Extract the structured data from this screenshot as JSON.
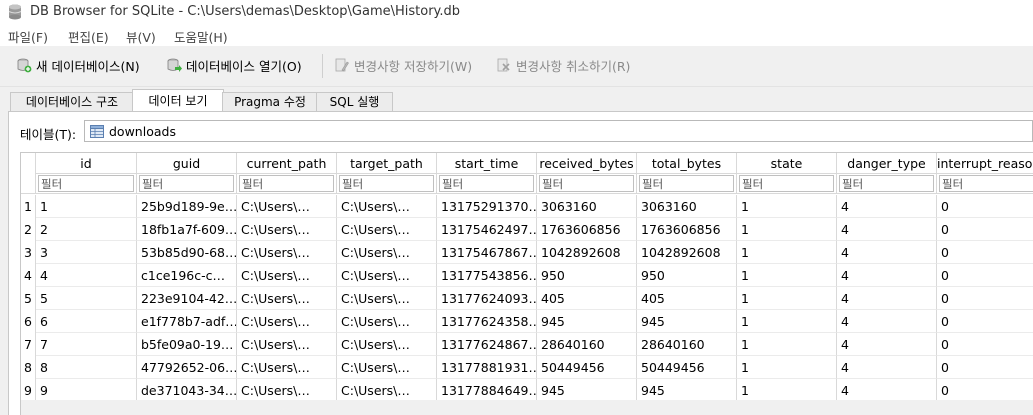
{
  "window": {
    "title": "DB Browser for SQLite - C:\\Users\\demas\\Desktop\\Game\\History.db",
    "icon": "database-icon"
  },
  "menu": [
    "파일(F)",
    "편집(E)",
    "뷰(V)",
    "도움말(H)"
  ],
  "toolbar": {
    "new_db": "새 데이터베이스(N)",
    "open_db": "데이터베이스 열기(O)",
    "write_changes": "변경사항 저장하기(W)",
    "revert_changes": "변경사항 취소하기(R)"
  },
  "tabs": [
    {
      "label": "데이터베이스 구조",
      "active": false
    },
    {
      "label": "데이터 보기",
      "active": true
    },
    {
      "label": "Pragma 수정",
      "active": false
    },
    {
      "label": "SQL 실행",
      "active": false
    }
  ],
  "table_selector": {
    "label": "테이블(T):",
    "value": "downloads"
  },
  "grid": {
    "filter_placeholder": "필터",
    "columns": [
      "id",
      "guid",
      "current_path",
      "target_path",
      "start_time",
      "received_bytes",
      "total_bytes",
      "state",
      "danger_type",
      "interrupt_reason"
    ],
    "rows": [
      {
        "num": "1",
        "cells": [
          "1",
          "25b9d189-9e…",
          "C:\\Users\\…",
          "C:\\Users\\…",
          "13175291370…",
          "3063160",
          "3063160",
          "1",
          "4",
          "0"
        ]
      },
      {
        "num": "2",
        "cells": [
          "2",
          "18fb1a7f-609…",
          "C:\\Users\\…",
          "C:\\Users\\…",
          "13175462497…",
          "1763606856",
          "1763606856",
          "1",
          "4",
          "0"
        ]
      },
      {
        "num": "3",
        "cells": [
          "3",
          "53b85d90-68…",
          "C:\\Users\\…",
          "C:\\Users\\…",
          "13175467867…",
          "1042892608",
          "1042892608",
          "1",
          "4",
          "0"
        ]
      },
      {
        "num": "4",
        "cells": [
          "4",
          "c1ce196c-c…",
          "C:\\Users\\…",
          "C:\\Users\\…",
          "13177543856…",
          "950",
          "950",
          "1",
          "4",
          "0"
        ]
      },
      {
        "num": "5",
        "cells": [
          "5",
          "223e9104-42…",
          "C:\\Users\\…",
          "C:\\Users\\…",
          "13177624093…",
          "405",
          "405",
          "1",
          "4",
          "0"
        ]
      },
      {
        "num": "6",
        "cells": [
          "6",
          "e1f778b7-adf…",
          "C:\\Users\\…",
          "C:\\Users\\…",
          "13177624358…",
          "945",
          "945",
          "1",
          "4",
          "0"
        ]
      },
      {
        "num": "7",
        "cells": [
          "7",
          "b5fe09a0-19…",
          "C:\\Users\\…",
          "C:\\Users\\…",
          "13177624867…",
          "28640160",
          "28640160",
          "1",
          "4",
          "0"
        ]
      },
      {
        "num": "8",
        "cells": [
          "8",
          "47792652-06…",
          "C:\\Users\\…",
          "C:\\Users\\…",
          "13177881931…",
          "50449456",
          "50449456",
          "1",
          "4",
          "0"
        ]
      },
      {
        "num": "9",
        "cells": [
          "9",
          "de371043-34…",
          "C:\\Users\\…",
          "C:\\Users\\…",
          "13177884649…",
          "945",
          "945",
          "1",
          "4",
          "0"
        ]
      }
    ]
  }
}
